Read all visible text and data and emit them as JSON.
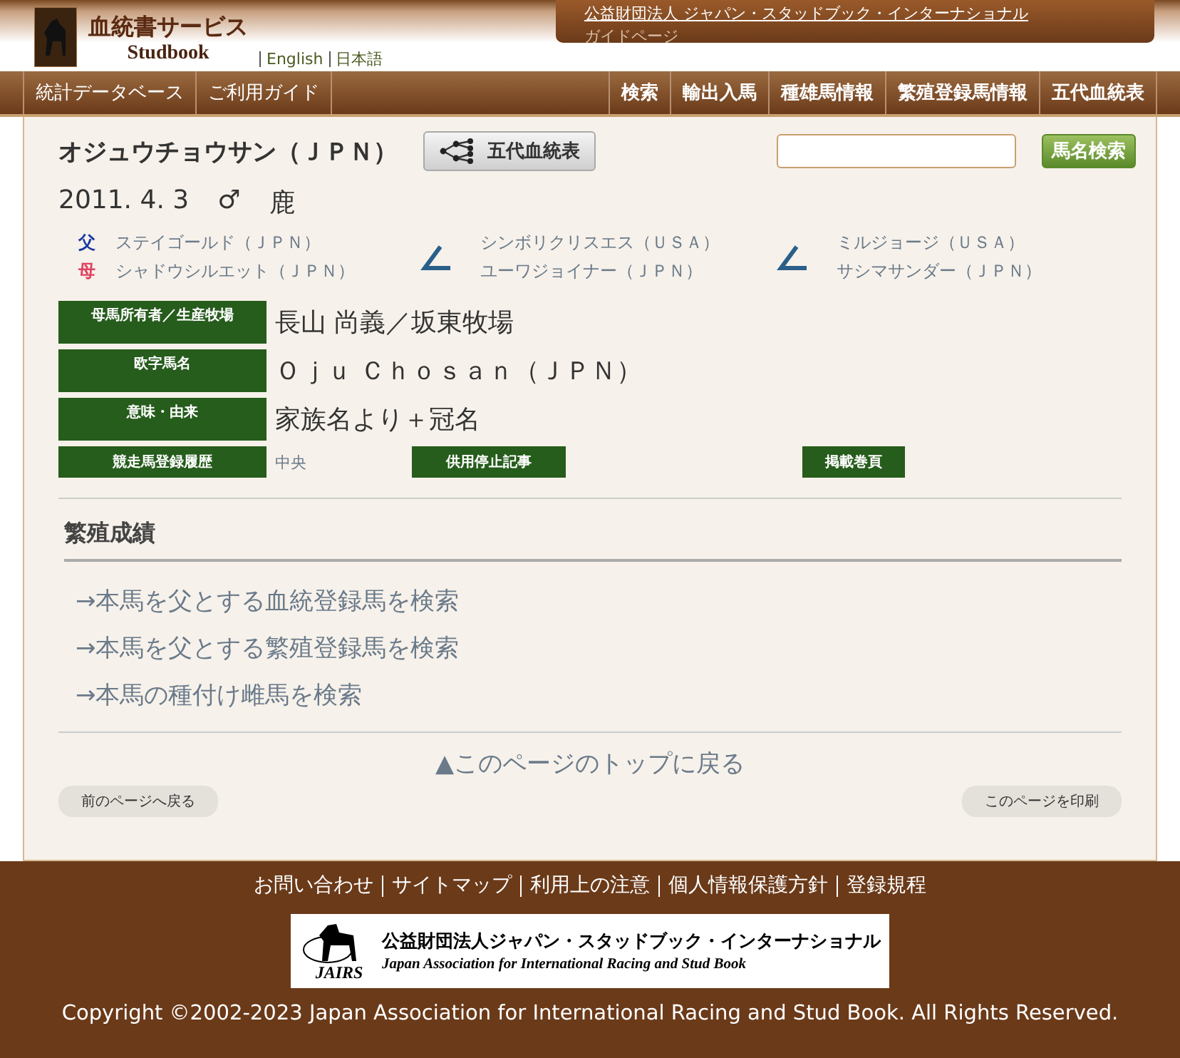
{
  "header": {
    "logo_title": "血統書サービス",
    "logo_subtitle": "Studbook",
    "languages": [
      "English",
      "日本語"
    ],
    "banner_links": [
      "公益財団法人 ジャパン・スタッドブック・インターナショナル",
      "ガイドページ"
    ]
  },
  "nav": {
    "left": [
      "統計データベース",
      "ご利用ガイド"
    ],
    "right": [
      "検索",
      "輸出入馬",
      "種雄馬情報",
      "繁殖登録馬情報",
      "五代血統表"
    ]
  },
  "horse": {
    "name": "オジュウチョウサン（ＪＰＮ）",
    "pedigree_button": "五代血統表",
    "search_button": "馬名検索",
    "birth_date": "2011. 4. 3",
    "sex": "♂",
    "coat": "鹿"
  },
  "parents": [
    {
      "label": "父",
      "name": "ステイゴールド（ＪＰＮ）",
      "kind": "sire"
    },
    {
      "label": "母",
      "name": "シャドウシルエット（ＪＰＮ）",
      "kind": "dam"
    }
  ],
  "ancestors": [
    [
      "シンボリクリスエス（ＵＳＡ）",
      "ユーワジョイナー（ＪＰＮ）"
    ],
    [
      "ミルジョージ（ＵＳＡ）",
      "サシマサンダー（ＪＰＮ）"
    ]
  ],
  "details": [
    {
      "label": "母馬所有者／生産牧場",
      "value": "長山 尚義／坂東牧場"
    },
    {
      "label": "欧字馬名",
      "value": "Ｏｊｕ Ｃｈｏｓａｎ（ＪＰＮ）"
    },
    {
      "label": "意味・由来",
      "value": "家族名より＋冠名"
    }
  ],
  "record": {
    "label": "競走馬登録履歴",
    "value": "中央",
    "buttons": [
      "供用停止記事",
      "掲載巻頁"
    ]
  },
  "section_title": "繁殖成績",
  "search_links": [
    "→本馬を父とする血統登録馬を検索",
    "→本馬を父とする繁殖登録馬を検索",
    "→本馬の種付け雌馬を検索"
  ],
  "top_link": "▲このページのトップに戻る",
  "back_button": "前のページへ戻る",
  "print_button": "このページを印刷",
  "footer": {
    "links": [
      "お問い合わせ",
      "サイトマップ",
      "利用上の注意",
      "個人情報保護方針",
      "登録規程"
    ],
    "logo_abbr": "JAIRS",
    "logo_name_ja": "公益財団法人ジャパン・スタッドブック・インターナショナル",
    "logo_name_en": "Japan Association for International Racing and Stud Book",
    "copyright": "Copyright ©2002-2023 Japan Association for International Racing and Stud Book. All Rights Reserved."
  }
}
